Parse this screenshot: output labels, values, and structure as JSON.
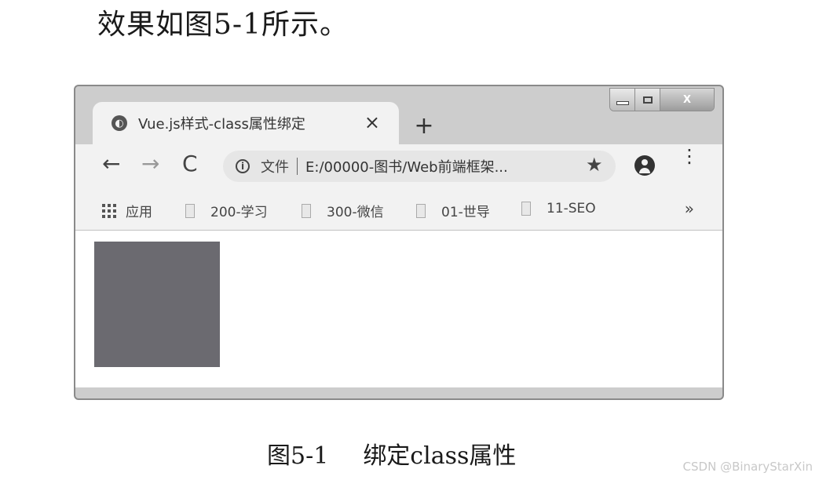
{
  "intro_text": "效果如图5-1所示。",
  "window": {
    "controls": {
      "minimize": "—",
      "maximize": "□",
      "close": "X"
    }
  },
  "tab": {
    "title": "Vue.js样式-class属性绑定",
    "close_glyph": "×",
    "new_tab_glyph": "+"
  },
  "toolbar": {
    "back_glyph": "←",
    "forward_glyph": "→",
    "reload_glyph": "C",
    "info_glyph": "i",
    "omnibox_label": "文件",
    "url": "E:/00000-图书/Web前端框架...",
    "star_glyph": "★",
    "menu_glyph": "⋮"
  },
  "bookmarks": {
    "apps_label": "应用",
    "items": [
      {
        "label": "200-学习"
      },
      {
        "label": "300-微信"
      },
      {
        "label": "01-世导"
      },
      {
        "label": "11-SEO"
      }
    ],
    "more_glyph": "»"
  },
  "content": {
    "box_color": "#6b6a70"
  },
  "caption": {
    "prefix": "图5-1",
    "text": "绑定class属性"
  },
  "watermark": "CSDN @BinaryStarXin"
}
